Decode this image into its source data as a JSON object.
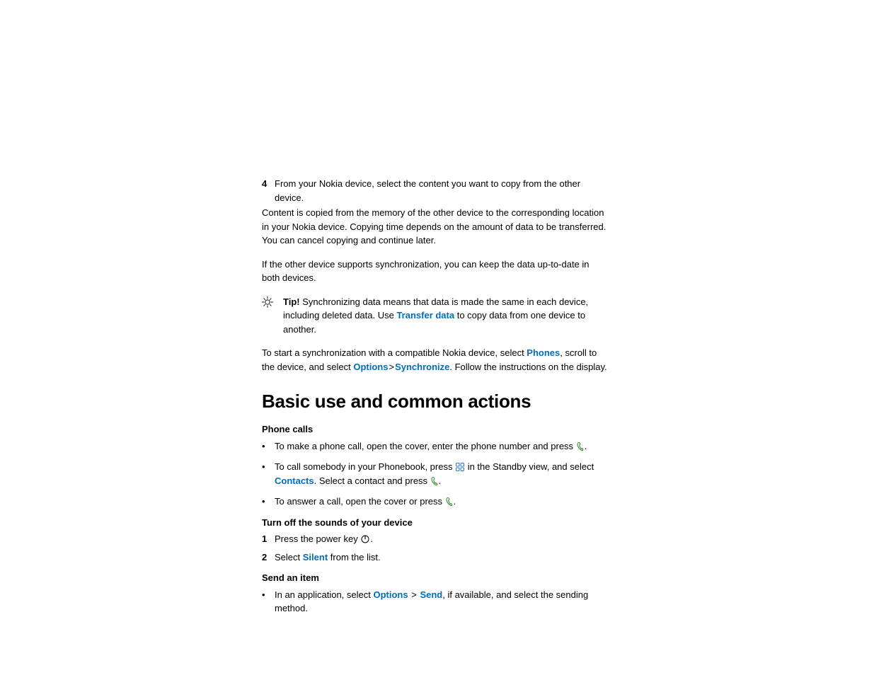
{
  "top_step": {
    "num": "4",
    "text": "From your Nokia device, select the content you want to copy from the other device."
  },
  "top_para": "Content is copied from the memory of the other device to the corresponding location in your Nokia device. Copying time depends on the amount of data to be transferred. You can cancel copying and continue later.",
  "sync_para": "If the other device supports synchronization, you can keep the data up-to-date in both devices.",
  "tip": {
    "label": "Tip!",
    "text1": " Synchronizing data means that data is made the same in each device, including deleted data. Use ",
    "link": "Transfer data",
    "text2": " to copy data from one device to another."
  },
  "start_sync": {
    "t1": "To start a synchronization with a compatible Nokia device, select ",
    "phones": "Phones",
    "t2": ", scroll to the device, and select ",
    "options": "Options",
    "gt": ">",
    "synchronize": "Synchronize",
    "t3": ". Follow the instructions on the display."
  },
  "heading": "Basic use and common actions",
  "phone_calls": {
    "heading": "Phone calls",
    "b1": "To make a phone call, open the cover, enter the phone number and press ",
    "b1_end": ".",
    "b2a": "To call somebody in your Phonebook, press ",
    "b2b": " in the Standby view, and select ",
    "b2_contacts": "Contacts",
    "b2c": ". Select a contact and press ",
    "b2_end": ".",
    "b3": "To answer a call, open the cover or press ",
    "b3_end": "."
  },
  "turn_off": {
    "heading": "Turn off the sounds of your device",
    "s1": "Press the power key ",
    "s1_end": ".",
    "s2a": "Select ",
    "s2_silent": "Silent",
    "s2b": " from the list."
  },
  "send_item": {
    "heading": "Send an item",
    "b1a": "In an application, select ",
    "b1_options": "Options",
    "b1_gt": ">",
    "b1_send": "Send",
    "b1b": ", if available, and select the sending method."
  }
}
